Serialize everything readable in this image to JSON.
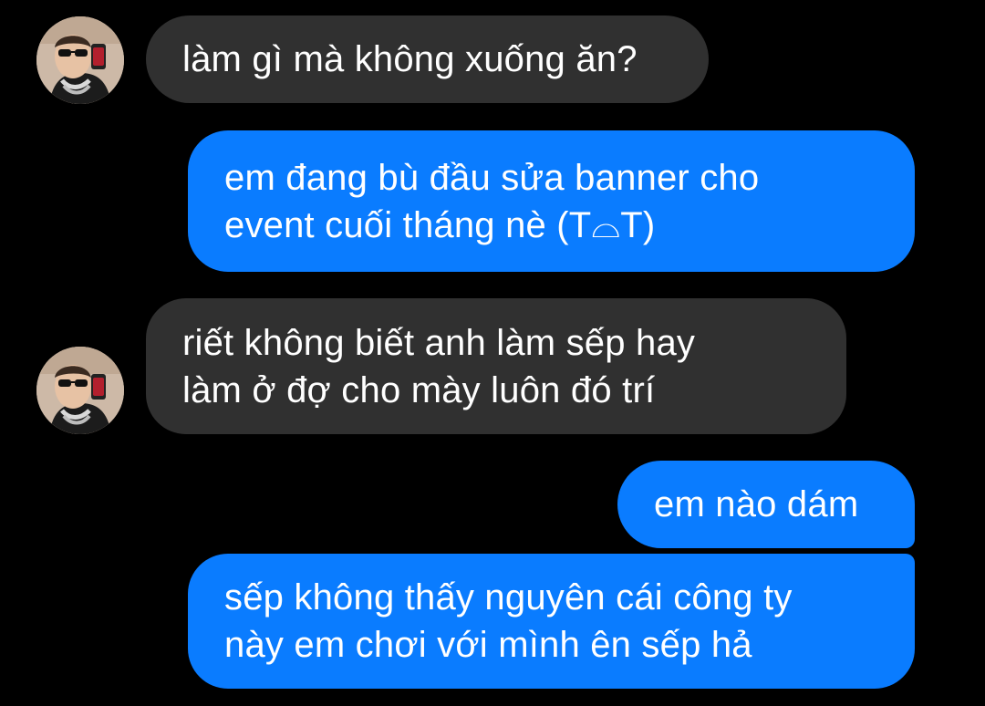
{
  "messages": [
    {
      "from": "contact",
      "text": "làm gì mà không xuống ăn?",
      "avatar": "contact-avatar"
    },
    {
      "from": "me",
      "text": "em đang bù đầu sửa banner cho\nevent cuối tháng nè (T⌓T)"
    },
    {
      "from": "contact",
      "text": "riết không biết anh làm sếp hay\nlàm ở đợ cho mày luôn đó trí",
      "avatar": "contact-avatar"
    },
    {
      "from": "me",
      "text": "em nào dám"
    },
    {
      "from": "me",
      "text": "sếp không thấy nguyên cái công ty\nnày em chơi với mình ên sếp hả"
    }
  ],
  "colors": {
    "background": "#000000",
    "incoming_bubble": "#303030",
    "outgoing_bubble": "#0a7cff",
    "text": "#ffffff"
  }
}
